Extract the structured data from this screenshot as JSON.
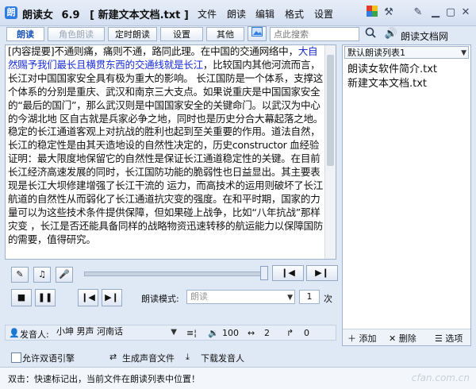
{
  "app": {
    "name": "朗读女",
    "version": "6.9",
    "document": "[ 新建文本文档.txt ]"
  },
  "menu": [
    "文件",
    "朗读",
    "编辑",
    "格式",
    "设置"
  ],
  "tabs": [
    {
      "label": "朗读",
      "state": "active"
    },
    {
      "label": "角色朗读",
      "state": "disabled"
    },
    {
      "label": "定时朗读",
      "state": "normal"
    },
    {
      "label": "设置",
      "state": "normal"
    },
    {
      "label": "其他",
      "state": "normal"
    }
  ],
  "search": {
    "placeholder": "点此搜索",
    "net_label": "朗读文档网"
  },
  "editor": {
    "prefix": "[内容提要]不通则痛，痛则不通，路同此理。在中国的交通网络中，",
    "highlight": "大自然赐予我们最长且横贯东西的交通线就是长江",
    "rest": "，比较国内其他河流而言，长江对中国国家安全具有极为重大的影响。 长江国防是一个体系，支撑这个体系的分别是重庆、武汉和南京三大支点。如果说重庆是中国国家安全的“最后的国门”，那么武汉则是中国国家安全的关键命门。以武汉为中心的今湖北地 区自古就是兵家必争之地，同时也是历史分合大幕起落之地。稳定的长江通道客观上对抗战的胜利也起到至关重要的作用。道法自然，长江的稳定性是由其天造地设的自然性决定的，历史constructor 血经验证明：最大限度地保留它的自然性是保证长江通道稳定性的关键。在目前长江经济高速发展的同时，长江国防功能的脆弱性也日益显出。其主要表现是长江大坝修建增强了长江干流的 运力，而高技术的运用则破坏了长江航道的自然性从而弱化了长江通道抗灾变的强度。在和平时期，国家的力量可以为这些技术条件提供保障，但如果碰上战争，比如“八年抗战”那样灾变 ，长江是否还能具备同样的战略物资迅速转移的航运能力以保障国防的需要，值得研究。"
  },
  "playlist": {
    "name": "默认朗读列表1",
    "items": [
      "朗读女软件简介.txt",
      "新建文本文档.txt"
    ],
    "add_label": "添加",
    "delete_label": "删除",
    "options_label": "选项"
  },
  "controls": {
    "mode_label": "朗读模式:",
    "mode_value": "朗读",
    "repeat_value": "1",
    "repeat_unit": "次",
    "speaker_label": "发音人:",
    "speaker_value": "小坤 男声 河南话",
    "volume": "100",
    "speed": "2",
    "pitch": "0"
  },
  "options": {
    "bilingual_label": "允许双语引擎",
    "gen_audio_label": "生成声音文件",
    "download_label": "下载发音人"
  },
  "status": {
    "text": "双击：快速标记出，当前文件在朗读列表中位置！",
    "watermark": "cfan.com.cn"
  },
  "colors": {
    "accent": "#1b55b8",
    "highlight_text": "#1a2fd6",
    "icon_blue": "#2f7de1"
  }
}
